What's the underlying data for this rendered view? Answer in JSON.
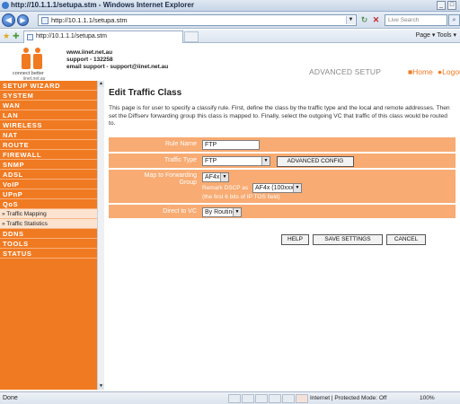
{
  "browser": {
    "title": "http://10.1.1.1/setupa.stm - Windows Internet Explorer",
    "url": "http://10.1.1.1/setupa.stm",
    "tab_label": "http://10.1.1.1/setupa.stm",
    "search_placeholder": "Live Search",
    "tools_text": "Page ▾  Tools ▾",
    "status_done": "Done",
    "status_zone": "Internet | Protected Mode: Off",
    "status_zoom": "100%"
  },
  "header": {
    "logo_tagline": "connect better",
    "logo_sub": "iinet.net.au",
    "contact_line1": "www.iinet.net.au",
    "contact_line2": "support - 132258",
    "contact_line3": "email support - support@iinet.net.au",
    "advanced_setup": "ADVANCED SETUP",
    "home_label": "■Home",
    "logout_label": "●Logou"
  },
  "sidebar": {
    "items": [
      "SETUP WIZARD",
      "SYSTEM",
      "WAN",
      "LAN",
      "WIRELESS",
      "NAT",
      "ROUTE",
      "FIREWALL",
      "SNMP",
      "ADSL",
      "VoIP",
      "UPnP",
      "QoS"
    ],
    "sub_items": [
      "» Traffic Mapping",
      "» Traffic Statistics"
    ],
    "items_after": [
      "DDNS",
      "TOOLS",
      "STATUS"
    ]
  },
  "main": {
    "heading": "Edit Traffic Class",
    "description": "This page is for user to specify a classify rule. First, define the class by the traffic type and the local and remote addresses. Then set the Diffserv forwarding group this class is mapped to. Finally, select the outgoing VC that traffic of this class would be routed to.",
    "rule_name_label": "Rule Name",
    "rule_name_value": "FTP",
    "traffic_type_label": "Traffic Type",
    "traffic_type_value": "FTP",
    "advanced_config_label": "ADVANCED CONFIG",
    "forwarding_label_1": "Map to Forwarding",
    "forwarding_label_2": "Group",
    "forwarding_value": "AF4x",
    "remark_label": "Remark DSCP as",
    "remark_value": "AF4x (100xxx)",
    "remark_note": "(the first 6 bits of IP TOS field)",
    "direct_vc_label": "Direct to VC",
    "direct_vc_value": "By Routing",
    "help_label": "HELP",
    "save_label": "SAVE SETTINGS",
    "cancel_label": "CANCEL"
  }
}
